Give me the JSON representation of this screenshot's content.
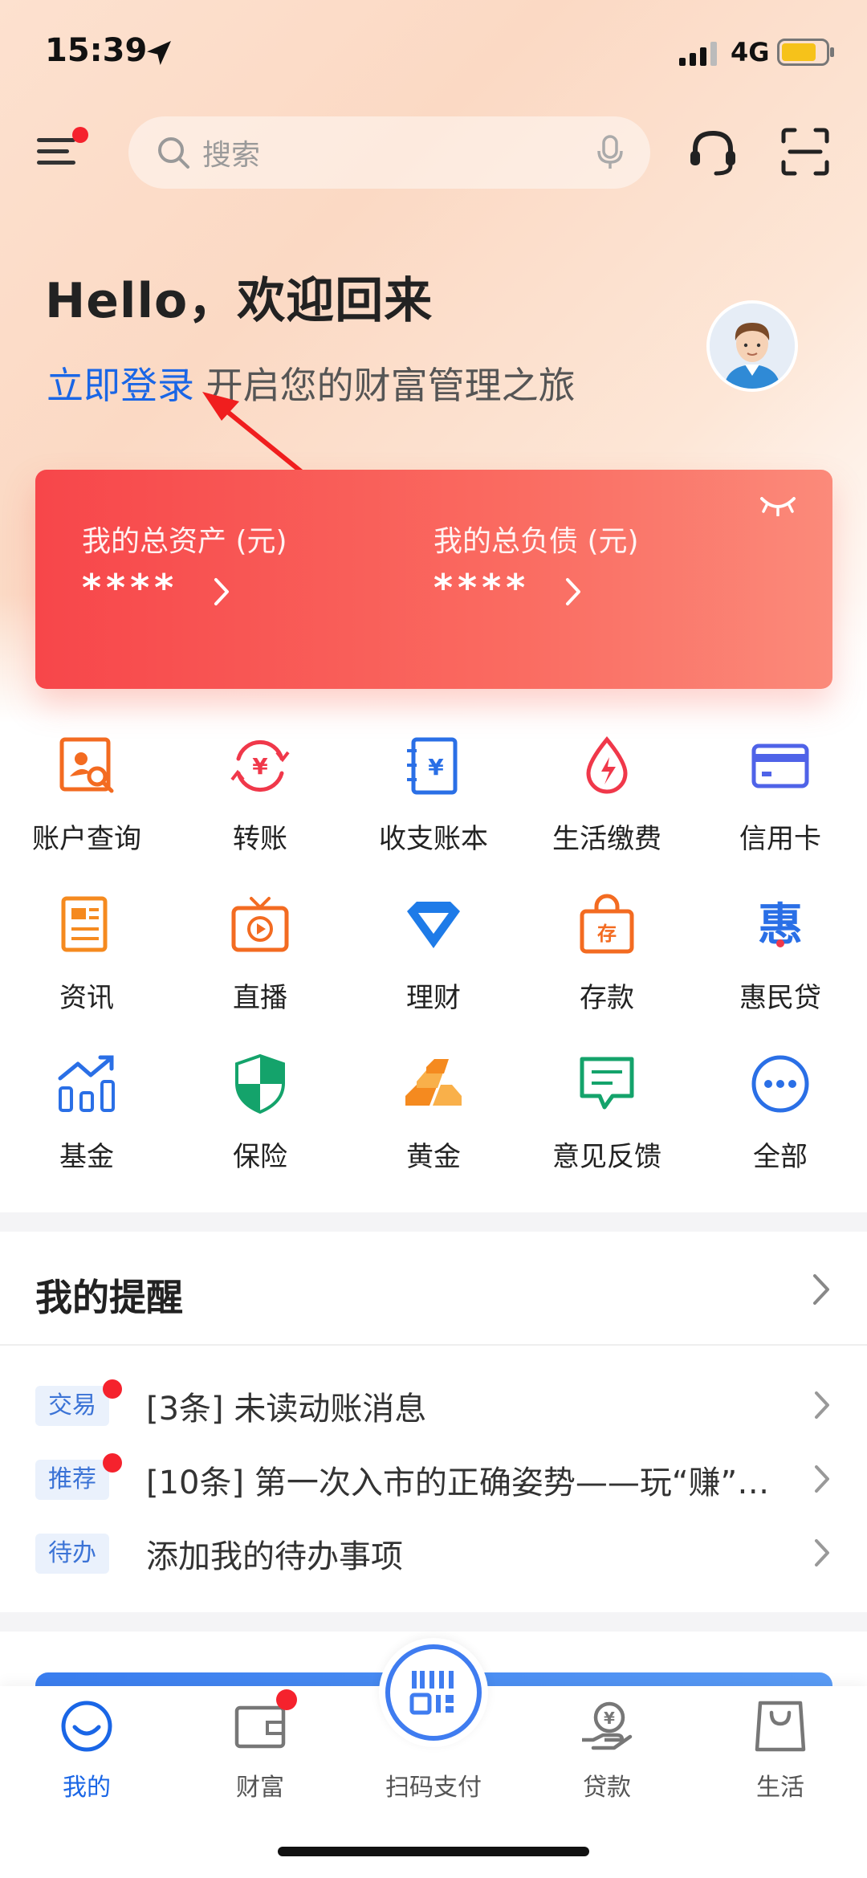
{
  "status_bar": {
    "time": "15:39",
    "network": "4G"
  },
  "header": {
    "search_placeholder": "搜索",
    "icons": [
      "menu-icon",
      "search-icon",
      "mic-icon",
      "headset-icon",
      "scan-icon"
    ]
  },
  "welcome": {
    "greeting": "Hello，欢迎回来",
    "login_link": "立即登录",
    "login_subtitle": " 开启您的财富管理之旅"
  },
  "assets": {
    "total_assets_label": "我的总资产 (元)",
    "total_assets_value": "****",
    "total_debt_label": "我的总负债 (元)",
    "total_debt_value": "****"
  },
  "grid": [
    {
      "label": "账户查询",
      "icon": "account-query-icon",
      "color": "#f36b21"
    },
    {
      "label": "转账",
      "icon": "transfer-icon",
      "color": "#f0384a"
    },
    {
      "label": "收支账本",
      "icon": "ledger-icon",
      "color": "#2a6fe6"
    },
    {
      "label": "生活缴费",
      "icon": "bill-pay-icon",
      "color": "#f0384a"
    },
    {
      "label": "信用卡",
      "icon": "credit-card-icon",
      "color": "#4f63e8"
    },
    {
      "label": "资讯",
      "icon": "news-icon",
      "color": "#f58a1f"
    },
    {
      "label": "直播",
      "icon": "live-icon",
      "color": "#f36b21"
    },
    {
      "label": "理财",
      "icon": "diamond-icon",
      "color": "#1e7be8"
    },
    {
      "label": "存款",
      "icon": "deposit-icon",
      "color": "#f36b21"
    },
    {
      "label": "惠民贷",
      "icon": "huimin-loan-icon",
      "color": "#2a6fe6"
    },
    {
      "label": "基金",
      "icon": "fund-icon",
      "color": "#2a6fe6"
    },
    {
      "label": "保险",
      "icon": "insurance-icon",
      "color": "#14a36b"
    },
    {
      "label": "黄金",
      "icon": "gold-icon",
      "color": "#f58a1f"
    },
    {
      "label": "意见反馈",
      "icon": "feedback-icon",
      "color": "#14a36b"
    },
    {
      "label": "全部",
      "icon": "more-icon",
      "color": "#2a6fe6"
    }
  ],
  "reminders": {
    "title": "我的提醒",
    "items": [
      {
        "tag": "交易",
        "text": "[3条] 未读动账消息",
        "unread": true
      },
      {
        "tag": "推荐",
        "text": "[10条] 第一次入市的正确姿势——玩“赚”…",
        "unread": true
      },
      {
        "tag": "待办",
        "text": "添加我的待办事项",
        "unread": false
      }
    ]
  },
  "tabbar": [
    {
      "label": "我的",
      "icon": "smile-icon",
      "active": true
    },
    {
      "label": "财富",
      "icon": "wallet-icon",
      "active": false
    },
    {
      "label": "扫码支付",
      "icon": "scan-pay-icon",
      "active": false
    },
    {
      "label": "贷款",
      "icon": "loan-icon",
      "active": false
    },
    {
      "label": "生活",
      "icon": "shopping-bag-icon",
      "active": false
    }
  ],
  "colors": {
    "accent": "#1a66e6",
    "card_start": "#f7464a",
    "card_end": "#fb8a7a",
    "badge_red": "#f5222d"
  }
}
